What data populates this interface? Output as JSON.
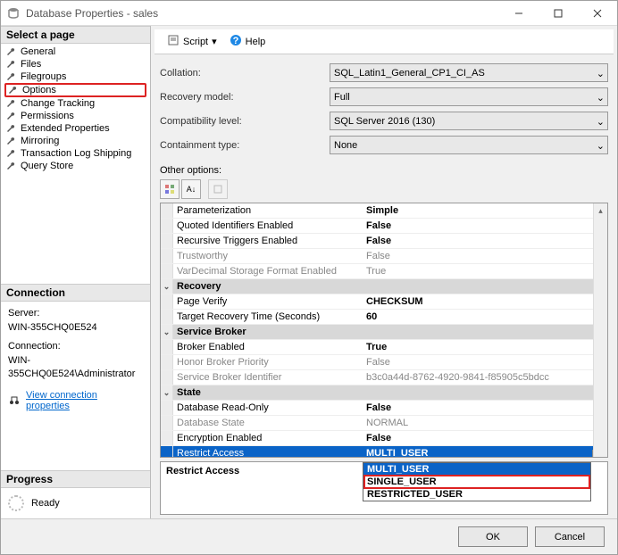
{
  "window": {
    "title": "Database Properties - sales"
  },
  "nav": {
    "header": "Select a page",
    "items": [
      "General",
      "Files",
      "Filegroups",
      "Options",
      "Change Tracking",
      "Permissions",
      "Extended Properties",
      "Mirroring",
      "Transaction Log Shipping",
      "Query Store"
    ],
    "highlighted": "Options"
  },
  "connection": {
    "header": "Connection",
    "server_lbl": "Server:",
    "server_val": "WIN-355CHQ0E524",
    "conn_lbl": "Connection:",
    "conn_val": "WIN-355CHQ0E524\\Administrator",
    "link": "View connection properties"
  },
  "progress": {
    "header": "Progress",
    "status": "Ready"
  },
  "toolbar": {
    "script": "Script",
    "help": "Help"
  },
  "form": {
    "collation": {
      "label": "Collation:",
      "value": "SQL_Latin1_General_CP1_CI_AS"
    },
    "recovery": {
      "label": "Recovery model:",
      "value": "Full"
    },
    "compat": {
      "label": "Compatibility level:",
      "value": "SQL Server 2016 (130)"
    },
    "contain": {
      "label": "Containment type:",
      "value": "None"
    },
    "other": "Other options:"
  },
  "grid": [
    {
      "k": "Parameterization",
      "v": "Simple",
      "bold": true
    },
    {
      "k": "Quoted Identifiers Enabled",
      "v": "False",
      "bold": true
    },
    {
      "k": "Recursive Triggers Enabled",
      "v": "False",
      "bold": true
    },
    {
      "k": "Trustworthy",
      "v": "False",
      "dis": true
    },
    {
      "k": "VarDecimal Storage Format Enabled",
      "v": "True",
      "dis": true
    },
    {
      "cat": "Recovery"
    },
    {
      "k": "Page Verify",
      "v": "CHECKSUM",
      "bold": true
    },
    {
      "k": "Target Recovery Time (Seconds)",
      "v": "60",
      "bold": true
    },
    {
      "cat": "Service Broker"
    },
    {
      "k": "Broker Enabled",
      "v": "True",
      "bold": true
    },
    {
      "k": "Honor Broker Priority",
      "v": "False",
      "dis": true
    },
    {
      "k": "Service Broker Identifier",
      "v": "b3c0a44d-8762-4920-9841-f85905c5bdcc",
      "dis": true
    },
    {
      "cat": "State"
    },
    {
      "k": "Database Read-Only",
      "v": "False",
      "bold": true
    },
    {
      "k": "Database State",
      "v": "NORMAL",
      "dis": true
    },
    {
      "k": "Encryption Enabled",
      "v": "False",
      "bold": true
    },
    {
      "k": "Restrict Access",
      "v": "MULTI_USER",
      "sel": true,
      "bold": true
    }
  ],
  "dropdown": {
    "options": [
      "MULTI_USER",
      "SINGLE_USER",
      "RESTRICTED_USER"
    ],
    "highlighted": "MULTI_USER",
    "boxed": "SINGLE_USER"
  },
  "desc": {
    "title": "Restrict Access"
  },
  "footer": {
    "ok": "OK",
    "cancel": "Cancel"
  }
}
